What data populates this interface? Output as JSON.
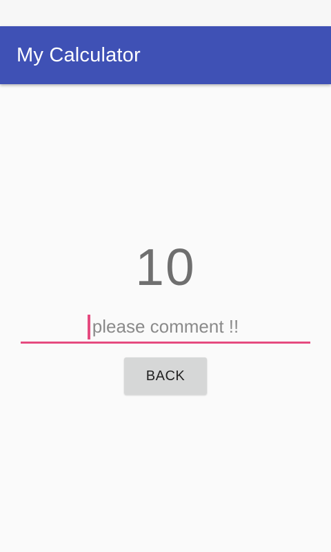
{
  "app": {
    "title": "My Calculator"
  },
  "main": {
    "result_value": "10",
    "comment": {
      "value": "",
      "placeholder": "please comment !!"
    },
    "back_label": "BACK"
  },
  "colors": {
    "primary": "#3f51b5",
    "accent": "#e54a7f",
    "background": "#fafafa",
    "button": "#d6d7d7"
  }
}
